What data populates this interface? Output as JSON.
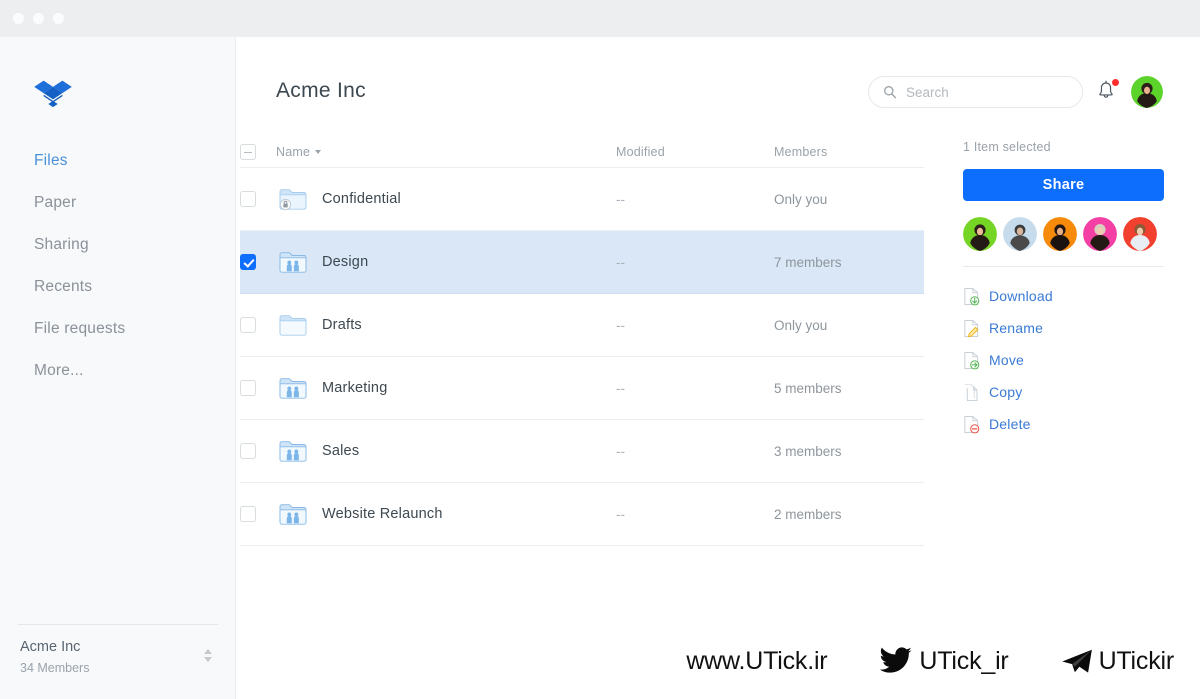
{
  "window": {
    "dots": [
      "close",
      "minimize",
      "maximize"
    ]
  },
  "sidebar": {
    "logo": "dropbox-logo",
    "items": [
      {
        "label": "Files",
        "active": true
      },
      {
        "label": "Paper",
        "active": false
      },
      {
        "label": "Sharing",
        "active": false
      },
      {
        "label": "Recents",
        "active": false
      },
      {
        "label": "File requests",
        "active": false
      },
      {
        "label": "More...",
        "active": false
      }
    ],
    "account": {
      "name": "Acme Inc",
      "members": "34 Members",
      "switcher_icon": "up-down-caret-icon"
    }
  },
  "header": {
    "title": "Acme Inc",
    "search": {
      "placeholder": "Search",
      "value": "",
      "icon": "search-icon"
    },
    "notifications": {
      "icon": "bell-icon",
      "has_badge": true,
      "badge_color": "#ff2d2d"
    },
    "avatar": {
      "name": "user-avatar",
      "color": "#5cd32a"
    }
  },
  "table": {
    "columns": {
      "name": "Name",
      "modified": "Modified",
      "members": "Members"
    },
    "sort": {
      "column": "Name",
      "direction": "desc",
      "icon": "sort-caret-icon"
    },
    "header_checkbox_state": "indeterminate",
    "rows": [
      {
        "name": "Confidential",
        "modified": "--",
        "members": "Only you",
        "icon": "folder-locked-icon",
        "checked": false,
        "selected": false
      },
      {
        "name": "Design",
        "modified": "--",
        "members": "7 members",
        "icon": "folder-shared-icon",
        "checked": true,
        "selected": true
      },
      {
        "name": "Drafts",
        "modified": "--",
        "members": "Only you",
        "icon": "folder-icon",
        "checked": false,
        "selected": false
      },
      {
        "name": "Marketing",
        "modified": "--",
        "members": "5 members",
        "icon": "folder-shared-icon",
        "checked": false,
        "selected": false
      },
      {
        "name": "Sales",
        "modified": "--",
        "members": "3 members",
        "icon": "folder-shared-icon",
        "checked": false,
        "selected": false
      },
      {
        "name": "Website Relaunch",
        "modified": "--",
        "members": "2 members",
        "icon": "folder-shared-icon",
        "checked": false,
        "selected": false
      }
    ]
  },
  "right_panel": {
    "selection_text": "1 Item selected",
    "share_label": "Share",
    "share_color": "#0d6efd",
    "members": [
      {
        "name": "member-avatar-1",
        "color": "#76d425"
      },
      {
        "name": "member-avatar-2",
        "color": "#c6dced"
      },
      {
        "name": "member-avatar-3",
        "color": "#f58a0b"
      },
      {
        "name": "member-avatar-4",
        "color": "#f43fa5"
      },
      {
        "name": "member-avatar-5",
        "color": "#f2402e"
      }
    ],
    "actions": [
      {
        "label": "Download",
        "icon": "download-icon",
        "badge_color": "#5cb85c"
      },
      {
        "label": "Rename",
        "icon": "rename-icon",
        "badge_color": "#e8b923"
      },
      {
        "label": "Move",
        "icon": "move-icon",
        "badge_color": "#5cb85c"
      },
      {
        "label": "Copy",
        "icon": "copy-icon",
        "badge_color": "#cfd6db"
      },
      {
        "label": "Delete",
        "icon": "delete-icon",
        "badge_color": "#e8564a"
      }
    ],
    "link_color": "#3a7bd5"
  },
  "watermark": {
    "site": "www.UTick.ir",
    "twitter": "UTick_ir",
    "telegram": "UTickir",
    "twitter_icon": "twitter-bird-icon",
    "telegram_icon": "telegram-plane-icon"
  }
}
